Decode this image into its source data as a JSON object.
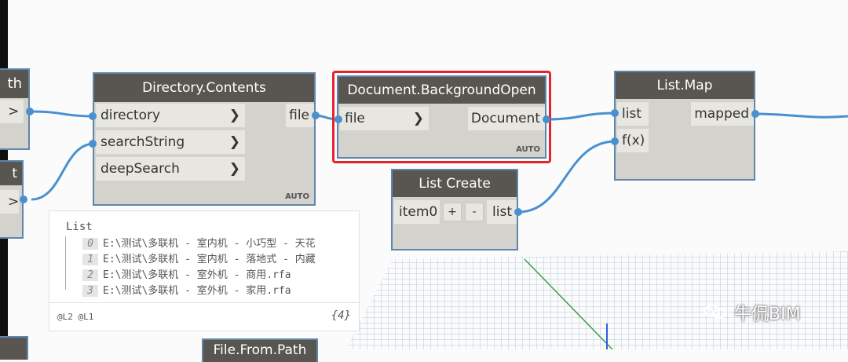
{
  "nodes": {
    "path_node": {
      "title": "th",
      "arrow": ">"
    },
    "string_node": {
      "title": "t",
      "arrow": ">"
    },
    "directory_contents": {
      "title": "Directory.Contents",
      "inputs": [
        "directory",
        "searchString",
        "deepSearch"
      ],
      "outputs": [
        "file"
      ],
      "lacing": "AUTO"
    },
    "document_open": {
      "title": "Document.BackgroundOpen",
      "inputs": [
        "file"
      ],
      "outputs": [
        "Document"
      ],
      "lacing": "AUTO"
    },
    "list_create": {
      "title": "List Create",
      "inputs": [
        "item0"
      ],
      "add_label": "+",
      "remove_label": "-",
      "outputs": [
        "list"
      ]
    },
    "list_map": {
      "title": "List.Map",
      "inputs": [
        "list",
        "f(x)"
      ],
      "outputs": [
        "mapped"
      ]
    },
    "bottom_node": {
      "title": "File.From.Path"
    }
  },
  "preview": {
    "title": "List",
    "items": [
      {
        "index": "0",
        "text": "E:\\测试\\多联机 - 室内机 - 小巧型 - 天花"
      },
      {
        "index": "1",
        "text": "E:\\测试\\多联机 - 室内机 - 落地式 - 内藏"
      },
      {
        "index": "2",
        "text": "E:\\测试\\多联机 - 室外机 - 商用.rfa"
      },
      {
        "index": "3",
        "text": "E:\\测试\\多联机 - 室外机 - 家用.rfa"
      }
    ],
    "levels": "@L2 @L1",
    "count": "{4}"
  },
  "watermark": "牛侃BIM",
  "colors": {
    "node_header": "#595651",
    "node_body": "#d3d2cc",
    "wire": "#4a90d0",
    "selection": "#e2262b"
  }
}
